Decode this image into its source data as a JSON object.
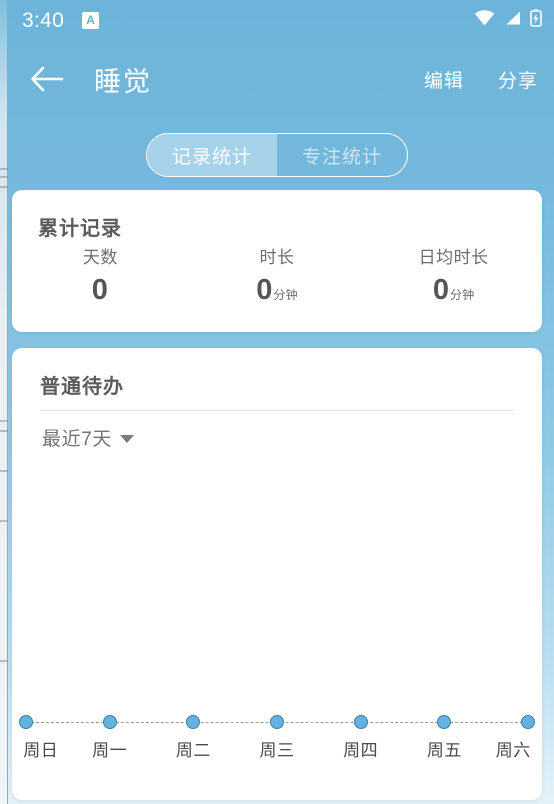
{
  "status_bar": {
    "clock": "3:40",
    "app_badge": "A",
    "icons": [
      "wifi-icon",
      "signal-icon",
      "battery-charging-icon"
    ]
  },
  "app_bar": {
    "back_icon": "arrow-left-icon",
    "title": "睡觉",
    "actions": [
      {
        "label": "编辑",
        "name": "edit-action"
      },
      {
        "label": "分享",
        "name": "share-action"
      }
    ]
  },
  "segmented_control": {
    "tabs": [
      {
        "label": "记录统计",
        "active": true
      },
      {
        "label": "专注统计",
        "active": false
      }
    ]
  },
  "summary_card": {
    "title": "累计记录",
    "stats": [
      {
        "label": "天数",
        "value": "0",
        "unit": ""
      },
      {
        "label": "时长",
        "value": "0",
        "unit": "分钟"
      },
      {
        "label": "日均时长",
        "value": "0",
        "unit": "分钟"
      }
    ]
  },
  "todo_card": {
    "title": "普通待办",
    "range_label": "最近7天",
    "range_caret_icon": "caret-down-icon"
  },
  "chart_data": {
    "type": "line",
    "title": "普通待办",
    "categories": [
      "周日",
      "周一",
      "周二",
      "周三",
      "周四",
      "周五",
      "周六"
    ],
    "values": [
      0,
      0,
      0,
      0,
      0,
      0,
      0
    ],
    "xlabel": "",
    "ylabel": "",
    "ylim": [
      0,
      0
    ],
    "grid": false,
    "legend": "none",
    "line_style": "dashed",
    "line_color": "#9a9a9a",
    "marker_color": "#63b2e0",
    "marker_border_color": "#3f7fa8"
  },
  "colors": {
    "header_blue": "#6cb4d9",
    "accent": "#63b2e0",
    "card_bg": "#ffffff",
    "segment_active_bg": "#a6d2ea",
    "text_primary": "#555555",
    "text_secondary": "#737373"
  }
}
